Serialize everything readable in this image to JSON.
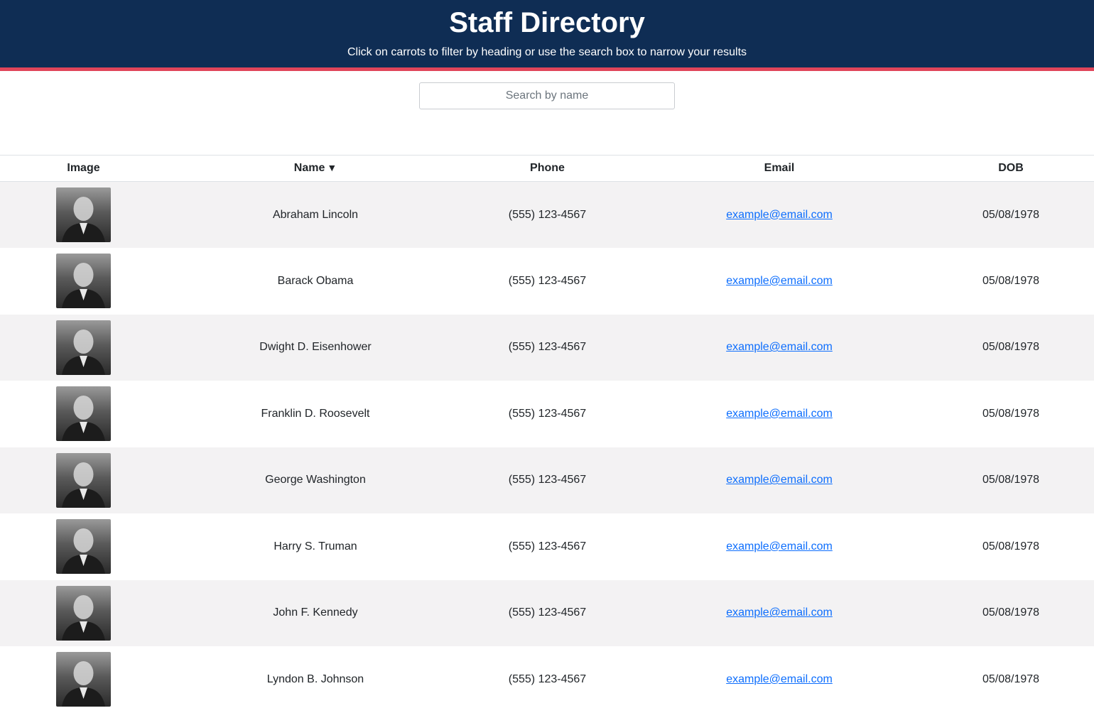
{
  "header": {
    "title": "Staff Directory",
    "subtitle": "Click on carrots to filter by heading or use the search box to narrow your results"
  },
  "search": {
    "placeholder": "Search by name",
    "value": ""
  },
  "table": {
    "columns": [
      "Image",
      "Name",
      "Phone",
      "Email",
      "DOB"
    ],
    "sort_caret": "▼",
    "rows": [
      {
        "name": "Abraham Lincoln",
        "phone": "(555) 123-4567",
        "email": "example@email.com",
        "dob": "05/08/1978"
      },
      {
        "name": "Barack Obama",
        "phone": "(555) 123-4567",
        "email": "example@email.com",
        "dob": "05/08/1978"
      },
      {
        "name": "Dwight D. Eisenhower",
        "phone": "(555) 123-4567",
        "email": "example@email.com",
        "dob": "05/08/1978"
      },
      {
        "name": "Franklin D. Roosevelt",
        "phone": "(555) 123-4567",
        "email": "example@email.com",
        "dob": "05/08/1978"
      },
      {
        "name": "George Washington",
        "phone": "(555) 123-4567",
        "email": "example@email.com",
        "dob": "05/08/1978"
      },
      {
        "name": "Harry S. Truman",
        "phone": "(555) 123-4567",
        "email": "example@email.com",
        "dob": "05/08/1978"
      },
      {
        "name": "John F. Kennedy",
        "phone": "(555) 123-4567",
        "email": "example@email.com",
        "dob": "05/08/1978"
      },
      {
        "name": "Lyndon B. Johnson",
        "phone": "(555) 123-4567",
        "email": "example@email.com",
        "dob": "05/08/1978"
      }
    ]
  },
  "colors": {
    "header_bg": "#0f2d54",
    "header_accent": "#e0455a",
    "link": "#0d6efd",
    "stripe": "#f3f2f3"
  }
}
